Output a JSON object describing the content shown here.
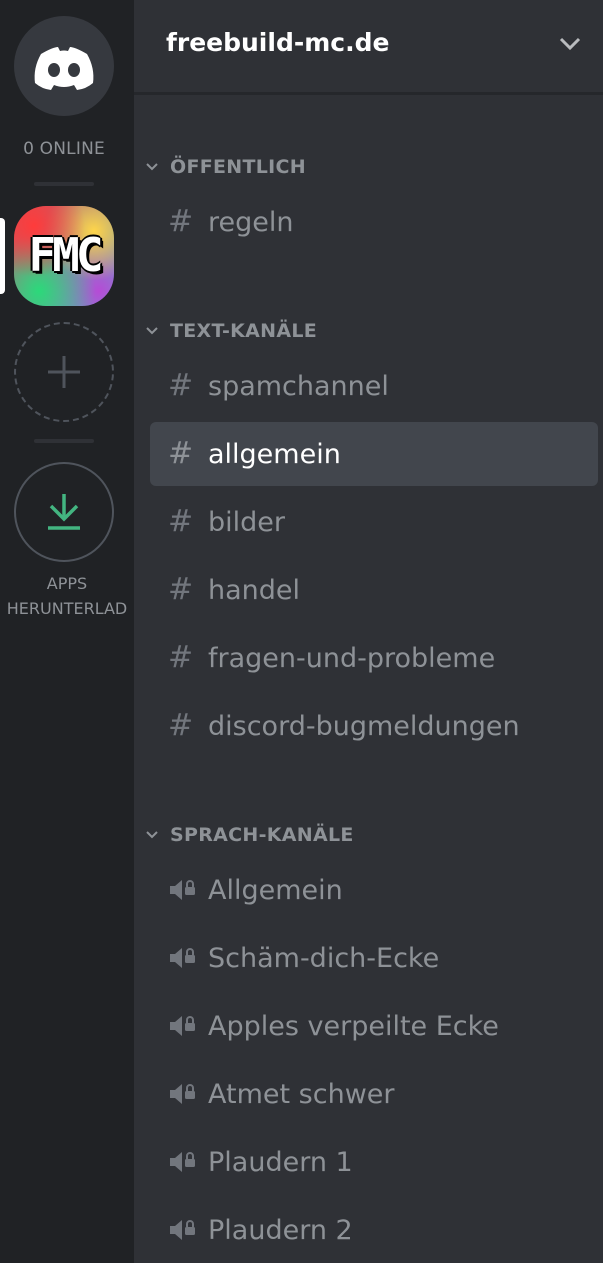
{
  "guild_bar": {
    "online_label": "0 ONLINE",
    "fmc_text": "FMC",
    "apps_label_line1": "APPS",
    "apps_label_line2": "HERUNTERLAD"
  },
  "server": {
    "name": "freebuild-mc.de"
  },
  "categories": {
    "public": "ÖFFENTLICH",
    "text": "TEXT-KANÄLE",
    "voice": "SPRACH-KANÄLE"
  },
  "public_channels": [
    "regeln"
  ],
  "text_channels": [
    "spamchannel",
    "allgemein",
    "bilder",
    "handel",
    "fragen-und-probleme",
    "discord-bugmeldungen"
  ],
  "active_channel": "allgemein",
  "voice_channels": [
    "Allgemein",
    "Schäm-dich-Ecke",
    "Apples verpeilte Ecke",
    "Atmet schwer",
    "Plaudern 1",
    "Plaudern 2"
  ],
  "icons": {
    "home": "discord-logo-icon",
    "add": "plus-icon",
    "download": "download-icon",
    "header": "chevron-down-icon",
    "text_channel": "hash-icon",
    "voice_channel": "locked-speaker-icon"
  },
  "colors": {
    "guild_bar_bg": "#202225",
    "channel_bg": "#2f3136",
    "active_bg": "#42464d",
    "download_green": "#43b581",
    "muted_text": "#8e9297"
  }
}
